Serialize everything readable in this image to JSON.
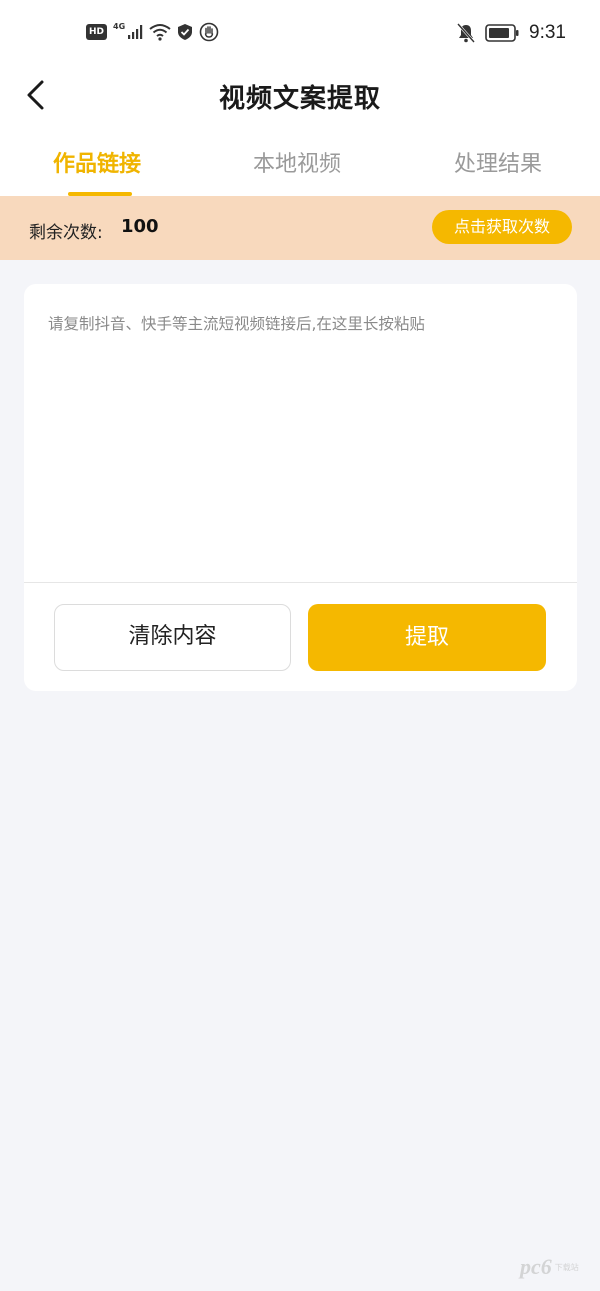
{
  "status_bar": {
    "hd_badge": "HD",
    "network_type": "4G",
    "time": "9:31",
    "icons": [
      "signal-icon",
      "wifi-icon",
      "shield-icon",
      "hand-icon",
      "bell-mute-icon",
      "battery-icon"
    ]
  },
  "header": {
    "title": "视频文案提取",
    "back_icon": "chevron-left-icon"
  },
  "tabs": [
    {
      "label": "作品链接",
      "active": true
    },
    {
      "label": "本地视频",
      "active": false
    },
    {
      "label": "处理结果",
      "active": false
    }
  ],
  "quota": {
    "label": "剩余次数:",
    "count": "100",
    "get_more_label": "点击获取次数"
  },
  "link_input": {
    "value": "",
    "placeholder": "请复制抖音、快手等主流短视频链接后,在这里长按粘贴"
  },
  "actions": {
    "clear_label": "清除内容",
    "extract_label": "提取"
  },
  "watermark": {
    "text": "pc6",
    "sub": "下载站"
  },
  "colors": {
    "accent": "#f5b800",
    "active_tab": "#f0b400",
    "quota_bg": "#f8d9bd",
    "page_bg": "#f4f5f9"
  }
}
